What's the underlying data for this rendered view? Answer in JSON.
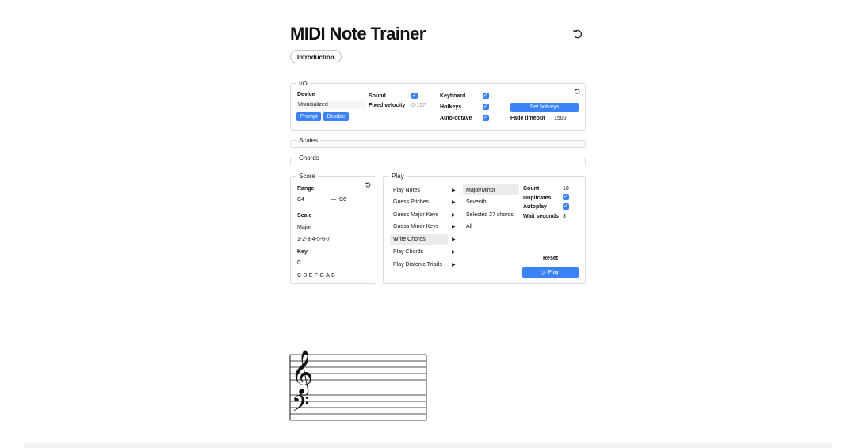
{
  "app": {
    "title": "MIDI Note Trainer",
    "intro_label": "Introduction"
  },
  "io": {
    "legend": "I/O",
    "device_label": "Device",
    "device_value": "Uninitialized",
    "prompt_label": "Prompt",
    "disable_label": "Disable",
    "sound_label": "Sound",
    "fixed_velocity_label": "Fixed velocity",
    "fixed_velocity_placeholder": "0-127",
    "keyboard_label": "Keyboard",
    "hotkeys_label": "Hotkeys",
    "auto_octave_label": "Auto-octave",
    "set_hotkeys_label": "Set hotkeys",
    "fade_timeout_label": "Fade timeout",
    "fade_timeout_value": "1500"
  },
  "scales": {
    "legend": "Scales"
  },
  "chords": {
    "legend": "Chords"
  },
  "score": {
    "legend": "Score",
    "range_label": "Range",
    "range_low": "C4",
    "range_high": "C6",
    "range_sep": "—",
    "scale_label": "Scale",
    "scale_value": "Major",
    "scale_degrees": "1-2-3-4-5-6-7",
    "key_label": "Key",
    "key_value": "C",
    "key_notes": "C-D-E-F-G-A-B"
  },
  "play": {
    "legend": "Play",
    "modes": [
      {
        "label": "Play Notes",
        "selected": false
      },
      {
        "label": "Guess Pitches",
        "selected": false
      },
      {
        "label": "Guess Major Keys",
        "selected": false
      },
      {
        "label": "Guess Minor Keys",
        "selected": false
      },
      {
        "label": "Write Chords",
        "selected": true
      },
      {
        "label": "Play Chords",
        "selected": false
      },
      {
        "label": "Play Diatonic Triads",
        "selected": false
      }
    ],
    "options": [
      {
        "label": "Major/Minor",
        "selected": true
      },
      {
        "label": "Seventh",
        "selected": false
      },
      {
        "label": "Selected 27 chords",
        "selected": false
      },
      {
        "label": "All",
        "selected": false
      }
    ],
    "count_label": "Count",
    "count_value": "10",
    "duplicates_label": "Duplicates",
    "autoplay_label": "Autoplay",
    "wait_seconds_label": "Wait seconds",
    "wait_seconds_value": "3",
    "reset_label": "Reset",
    "play_label": "▷  Play"
  },
  "colors": {
    "accent": "#3b82f6",
    "border": "#dcdcdc",
    "selected": "#ececec"
  },
  "icons": {
    "reset": "reset-icon",
    "treble": "treble-clef-icon",
    "bass": "bass-clef-icon",
    "check": "checkbox-check-icon"
  }
}
